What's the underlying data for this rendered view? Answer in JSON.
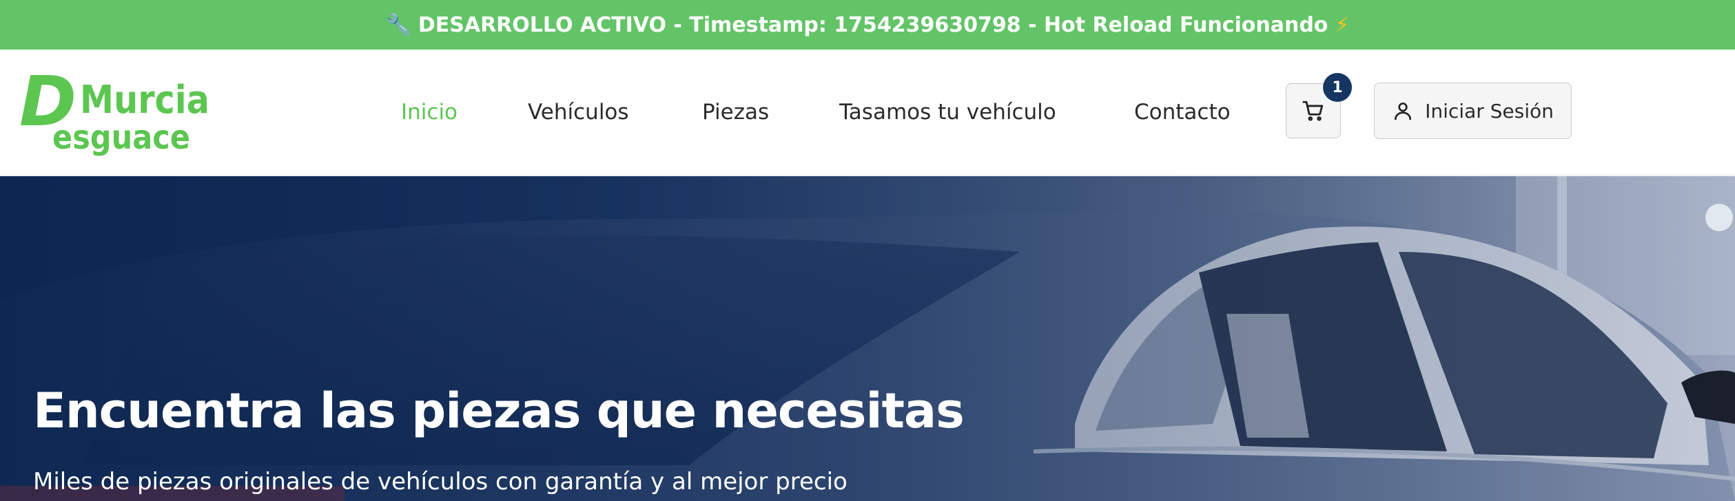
{
  "dev_banner": {
    "icon_left": "🔧",
    "text": "DESARROLLO ACTIVO - Timestamp: 1754239630798 - Hot Reload Funcionando",
    "icon_right": "⚡"
  },
  "header": {
    "logo": {
      "line1_big": "D",
      "line1_rest": "Murcia",
      "line2": "esguace"
    },
    "nav": [
      {
        "label": "Inicio",
        "active": true
      },
      {
        "label": "Vehículos",
        "active": false
      },
      {
        "label": "Piezas",
        "active": false
      },
      {
        "label": "Tasamos tu vehículo",
        "active": false
      },
      {
        "label": "Contacto",
        "active": false
      }
    ],
    "cart": {
      "icon": "shopping-cart-icon",
      "count": "1"
    },
    "login": {
      "icon": "user-icon",
      "label": "Iniciar Sesión"
    }
  },
  "hero": {
    "title": "Encuentra las piezas que necesitas",
    "subtitle": "Miles de piezas originales de vehículos con garantía y al mejor precio"
  },
  "colors": {
    "banner_green": "#63c467",
    "brand_green": "#5cc650",
    "badge_navy": "#163563",
    "hero_navy": "#0f2c57"
  }
}
